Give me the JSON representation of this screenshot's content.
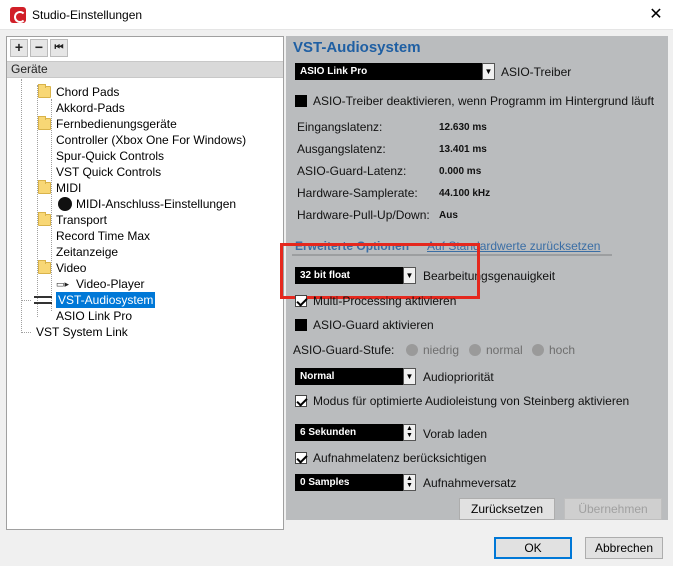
{
  "window": {
    "title": "Studio-Einstellungen"
  },
  "toolbar": {
    "add": "+",
    "remove": "−",
    "reset": "⏮"
  },
  "tree": {
    "header": "Geräte",
    "items": [
      "Chord Pads",
      "Akkord-Pads",
      "Fernbedienungsgeräte",
      "Controller (Xbox One For Windows)",
      "Spur-Quick Controls",
      "VST Quick Controls",
      "MIDI",
      "MIDI-Anschluss-Einstellungen",
      "Transport",
      "Record Time Max",
      "Zeitanzeige",
      "Video",
      "Video-Player",
      "VST-Audiosystem",
      "ASIO Link Pro",
      "VST System Link"
    ]
  },
  "panel": {
    "title": "VST-Audiosystem",
    "driver_select": "ASIO Link Pro",
    "driver_label": "ASIO-Treiber",
    "deactivate_label": "ASIO-Treiber deaktivieren, wenn Programm im Hintergrund läuft",
    "info": [
      {
        "label": "Eingangslatenz:",
        "value": "12.630 ms"
      },
      {
        "label": "Ausgangslatenz:",
        "value": "13.401 ms"
      },
      {
        "label": "ASIO-Guard-Latenz:",
        "value": "0.000 ms"
      },
      {
        "label": "Hardware-Samplerate:",
        "value": "44.100 kHz"
      },
      {
        "label": "Hardware-Pull-Up/Down:",
        "value": "Aus"
      }
    ],
    "advanced_label": "Erweiterte Optionen",
    "defaults_link": "Auf Standardwerte zurücksetzen",
    "precision_select": "32 bit float",
    "precision_label": "Bearbeitungsgenauigkeit",
    "multiprocessing_label": "Multi-Processing aktivieren",
    "asioguard_label": "ASIO-Guard aktivieren",
    "asioguard_level_label": "ASIO-Guard-Stufe:",
    "level_options": [
      "niedrig",
      "normal",
      "hoch"
    ],
    "priority_select": "Normal",
    "priority_label": "Audiopriorität",
    "steinberg_label": "Modus für optimierte Audioleistung von Steinberg aktivieren",
    "preload_value": "6 Sekunden",
    "preload_label": "Vorab laden",
    "latency_label": "Aufnahmelatenz berücksichtigen",
    "offset_value": "0 Samples",
    "offset_label": "Aufnahmeversatz",
    "reset_button": "Zurücksetzen",
    "apply_button": "Übernehmen"
  },
  "footer": {
    "ok": "OK",
    "cancel": "Abbrechen"
  },
  "colors": {
    "accent": "#1f5fa3",
    "selection": "#0078d7",
    "highlight": "#e5281e",
    "panel": "#babcbe"
  }
}
